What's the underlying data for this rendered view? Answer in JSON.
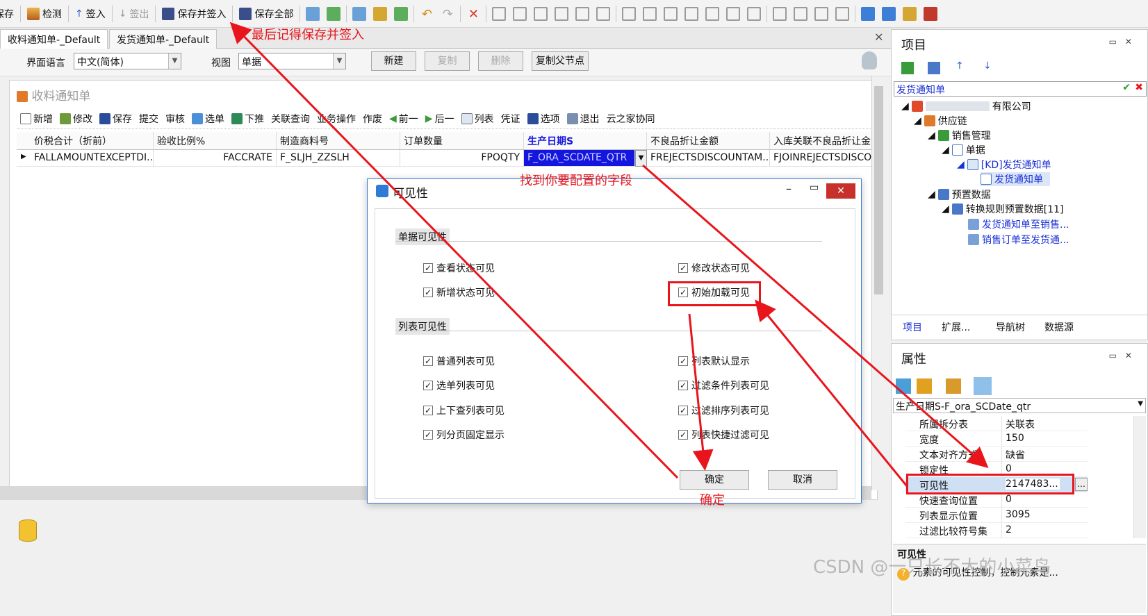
{
  "toolbar": {
    "items": [
      {
        "label": "保存",
        "icon": "save-icon",
        "disabled": false
      },
      {
        "label": "检测",
        "icon": "check-icon",
        "disabled": false
      },
      {
        "label": "签入",
        "icon": "arrow-up-icon",
        "disabled": false
      },
      {
        "label": "签出",
        "icon": "arrow-down-icon",
        "disabled": true
      },
      {
        "label": "保存并签入",
        "icon": "save-checkin-icon",
        "disabled": false
      },
      {
        "label": "保存全部",
        "icon": "save-all-icon",
        "disabled": false
      }
    ]
  },
  "doc_tabs": [
    "收料通知单-_Default",
    "发货通知单-_Default"
  ],
  "filter": {
    "lang_label": "界面语言",
    "lang_value": "中文(简体)",
    "view_label": "视图",
    "view_value": "单据",
    "buttons": [
      "新建",
      "复制",
      "删除",
      "复制父节点"
    ]
  },
  "form": {
    "title": "收料通知单",
    "toolbar": [
      "新增",
      "修改",
      "保存",
      "提交",
      "审核",
      "选单",
      "下推",
      "关联查询",
      "业务操作",
      "作废",
      "前一",
      "后一",
      "列表",
      "凭证",
      "选项",
      "退出",
      "云之家协同"
    ],
    "columns": [
      "价税合计（折前）",
      "验收比例%",
      "制造商料号",
      "订单数量",
      "生产日期S",
      "不良品折让金额",
      "入库关联不良品折让金"
    ],
    "row": [
      "FALLAMOUNTEXCEPTDI...",
      "FACCRATE",
      "F_SLJH_ZZSLH",
      "FPOQTY",
      "F_ORA_SCDATE_QTR",
      "FREJECTSDISCOUNTAM...",
      "FJOINREJECTSDISCO"
    ]
  },
  "dialog": {
    "title": "可见性",
    "section1": "单据可见性",
    "section2": "列表可见性",
    "bill_items": [
      {
        "label": "查看状态可见",
        "checked": true
      },
      {
        "label": "修改状态可见",
        "checked": true
      },
      {
        "label": "新增状态可见",
        "checked": true
      },
      {
        "label": "初始加载可见",
        "checked": true
      }
    ],
    "list_items": [
      {
        "label": "普通列表可见",
        "checked": true
      },
      {
        "label": "列表默认显示",
        "checked": true
      },
      {
        "label": "选单列表可见",
        "checked": true
      },
      {
        "label": "过滤条件列表可见",
        "checked": true
      },
      {
        "label": "上下查列表可见",
        "checked": true
      },
      {
        "label": "过滤排序列表可见",
        "checked": true
      },
      {
        "label": "列分页固定显示",
        "checked": true
      },
      {
        "label": "列表快捷过滤可见",
        "checked": true
      }
    ],
    "ok": "确定",
    "cancel": "取消"
  },
  "project": {
    "title": "项目",
    "search_value": "发货通知单",
    "tree": [
      {
        "label": "有限公司",
        "link": false
      },
      {
        "label": "供应链",
        "link": false
      },
      {
        "label": "销售管理",
        "link": false
      },
      {
        "label": "单据",
        "link": false
      },
      {
        "label": "[KD]发货通知单",
        "link": true
      },
      {
        "label": "发货通知单",
        "link": true
      },
      {
        "label": "预置数据",
        "link": false
      },
      {
        "label": "转换规则预置数据[11]",
        "link": false
      },
      {
        "label": "发货通知单至销售...",
        "link": true
      },
      {
        "label": "销售订单至发货通...",
        "link": true
      }
    ],
    "tabs": [
      "项目",
      "扩展...",
      "导航树",
      "数据源"
    ]
  },
  "props": {
    "title": "属性",
    "selector": "生产日期S-F_ora_SCDate_qtr",
    "rows": [
      {
        "name": "所属拆分表",
        "value": "关联表"
      },
      {
        "name": "宽度",
        "value": "150"
      },
      {
        "name": "文本对齐方式",
        "value": "缺省"
      },
      {
        "name": "锁定性",
        "value": "0"
      },
      {
        "name": "可见性",
        "value": "2147483..."
      },
      {
        "name": "快速查询位置",
        "value": "0"
      },
      {
        "name": "列表显示位置",
        "value": "3095"
      },
      {
        "name": "过滤比较符号集",
        "value": "2"
      }
    ],
    "desc_title": "可见性",
    "desc_text": "元素的可见性控制，控制元素是..."
  },
  "annotations": {
    "save_hint": "最后记得保存并签入",
    "field_hint": "找到你要配置的字段",
    "ok_hint": "确定"
  },
  "watermark": "CSDN @一只长不大的小菜鸟",
  "colors": {
    "annotation": "#e8151c",
    "selection": "#1515e0",
    "link": "#1a2fd6"
  }
}
